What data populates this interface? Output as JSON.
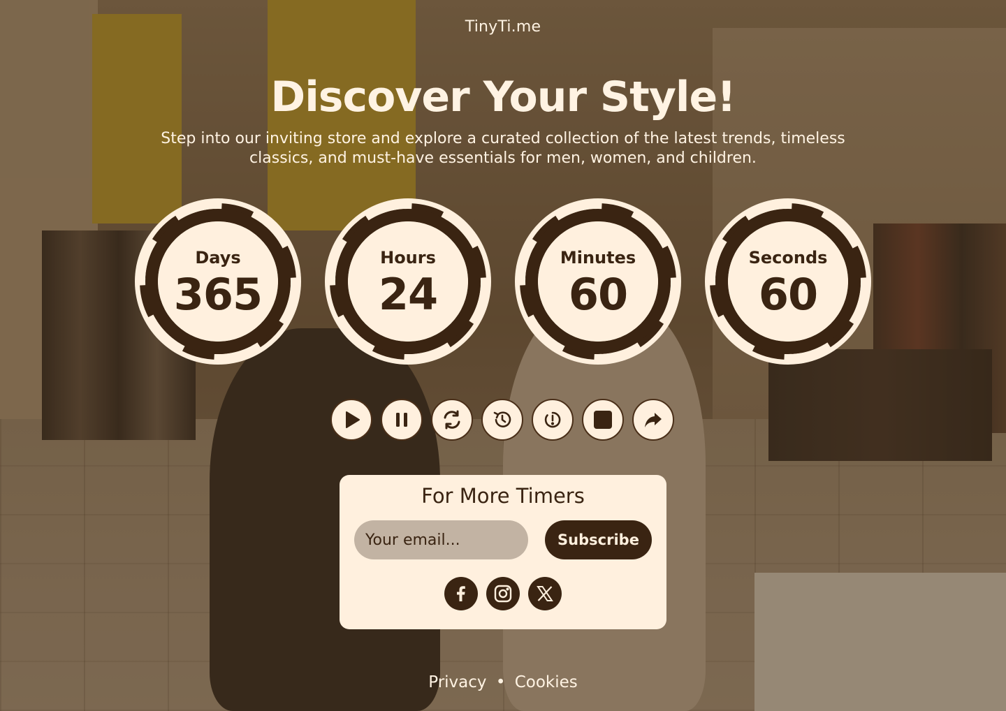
{
  "brand": "TinyTi.me",
  "hero": {
    "title": "Discover Your Style!",
    "subtitle": "Step into our inviting store and explore a curated collection of the latest trends, timeless classics, and must-have essentials for men, women, and children."
  },
  "countdown": [
    {
      "label": "Days",
      "value": "365"
    },
    {
      "label": "Hours",
      "value": "24"
    },
    {
      "label": "Minutes",
      "value": "60"
    },
    {
      "label": "Seconds",
      "value": "60"
    }
  ],
  "controls": [
    "play-icon",
    "pause-icon",
    "refresh-icon",
    "history-icon",
    "timer-reset-icon",
    "stop-icon",
    "share-icon"
  ],
  "subscribe": {
    "title": "For More Timers",
    "email_placeholder": "Your email...",
    "button_label": "Subscribe"
  },
  "social": [
    "facebook-icon",
    "instagram-icon",
    "x-icon"
  ],
  "footer": {
    "privacy": "Privacy",
    "separator": "•",
    "cookies": "Cookies"
  },
  "colors": {
    "accent_dark": "#3a2412",
    "cream": "#fff0de",
    "overlay": "#463018"
  }
}
